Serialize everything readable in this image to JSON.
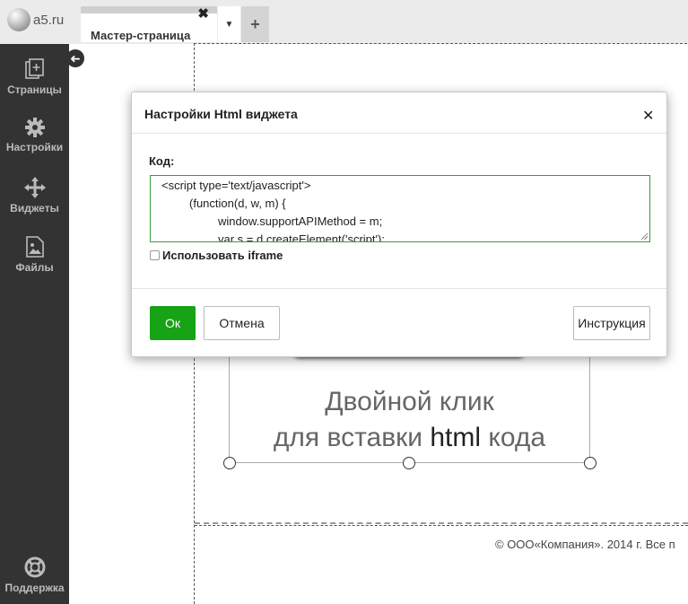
{
  "logo": {
    "text": "a5.ru"
  },
  "tab": {
    "label": "Мастер-страница",
    "close_glyph": "✖",
    "dropdown_glyph": "▼",
    "add_glyph": "+"
  },
  "sidebar": {
    "items": [
      {
        "label": "Страницы",
        "icon": "pages-icon"
      },
      {
        "label": "Настройки",
        "icon": "gear-icon"
      },
      {
        "label": "Виджеты",
        "icon": "move-icon"
      },
      {
        "label": "Файлы",
        "icon": "image-file-icon"
      },
      {
        "label": "Поддержка",
        "icon": "lifebuoy-icon"
      }
    ],
    "collapse_glyph": "➜"
  },
  "canvas": {
    "widget_line1": "Двойной клик",
    "widget_line2_pre": "для вставки ",
    "widget_line2_hl": "html",
    "widget_line2_post": " кода",
    "footer": "© ООО«Компания». 2014 г. Все п"
  },
  "modal": {
    "title": "Настройки Html виджета",
    "close_glyph": "✕",
    "code_label": "Код:",
    "code_lines": [
      "<script type='text/javascript'>",
      "(function(d, w, m) {",
      "window.supportAPIMethod = m;",
      "var s = d.createElement('script');"
    ],
    "iframe_label": "Использовать iframe",
    "ok_label": "Ок",
    "cancel_label": "Отмена",
    "help_label": "Инструкция"
  },
  "colors": {
    "accent": "#16a316",
    "sidebar": "#333333",
    "topbar": "#ebebeb"
  }
}
